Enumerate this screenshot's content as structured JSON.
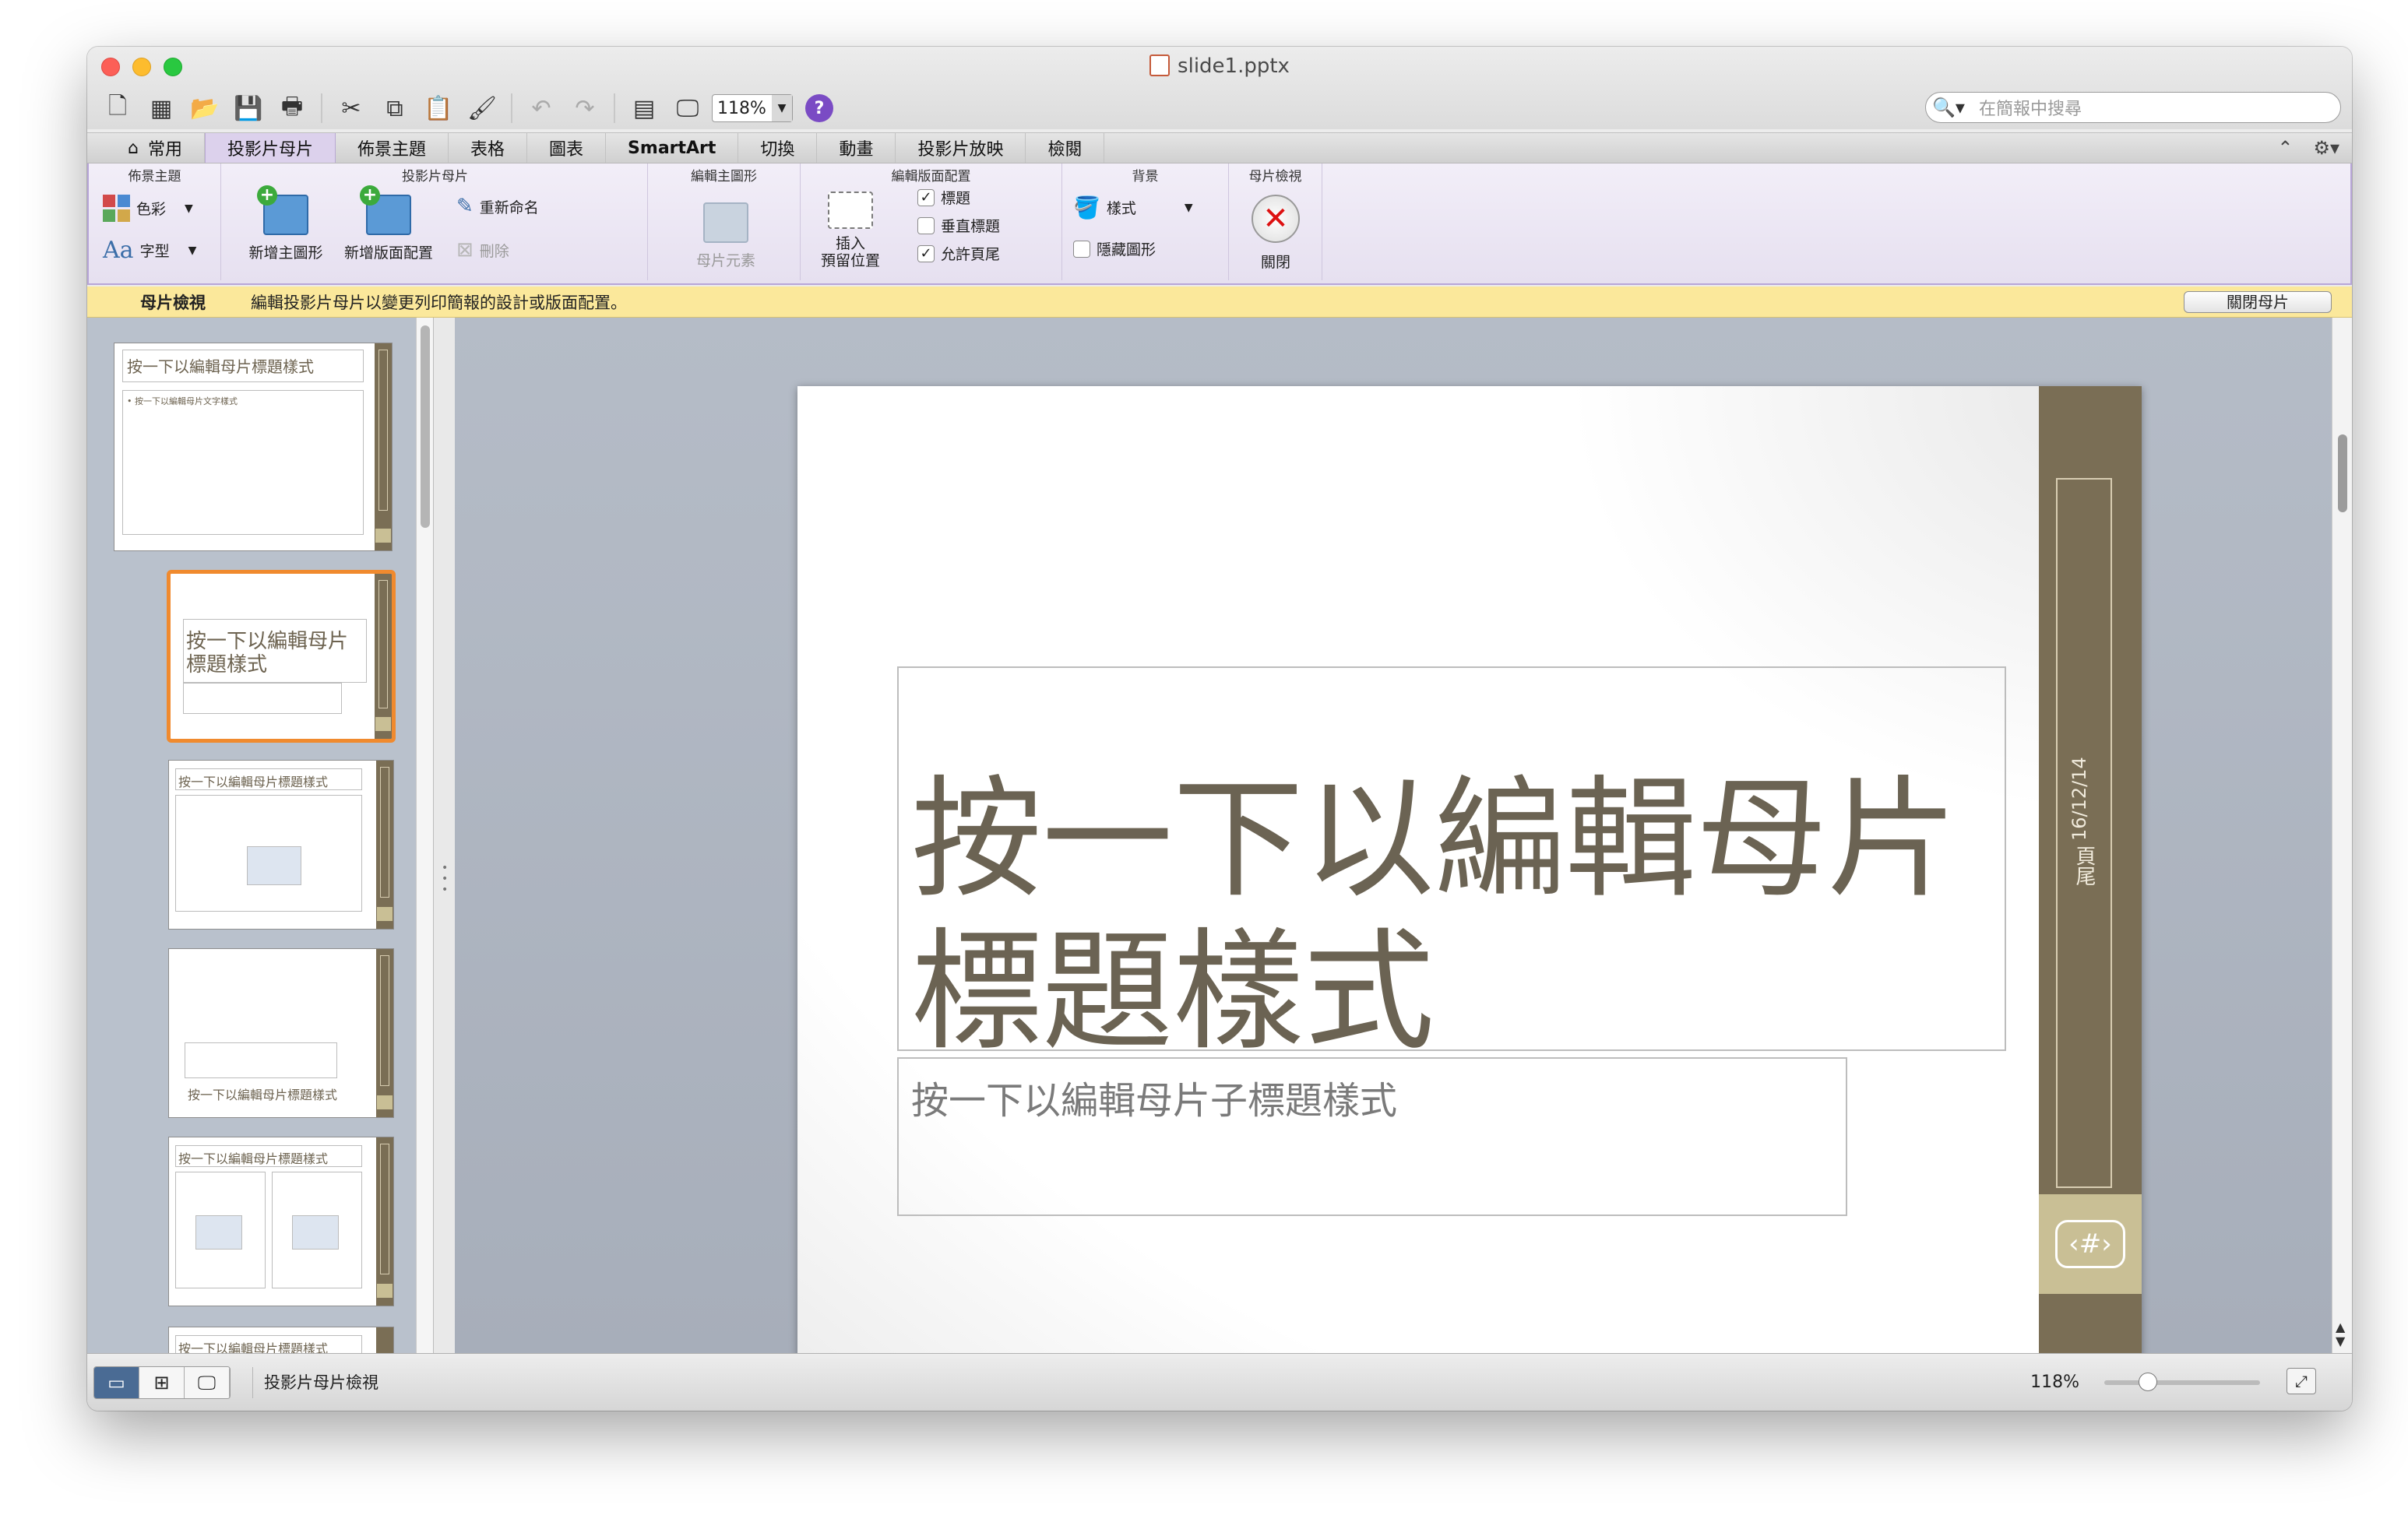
{
  "window": {
    "title": "slide1.pptx"
  },
  "toolbar": {
    "zoom_value": "118%",
    "search_placeholder": "在簡報中搜尋",
    "icons": [
      "new-icon",
      "gallery-icon",
      "open-icon",
      "save-icon",
      "print-icon",
      "cut-icon",
      "copy-icon",
      "paste-icon",
      "format-painter-icon",
      "undo-icon",
      "redo-icon",
      "slide-sorter-icon",
      "show-icon",
      "help-icon"
    ]
  },
  "tabs": [
    {
      "label": "常用"
    },
    {
      "label": "投影片母片",
      "active": true
    },
    {
      "label": "佈景主題"
    },
    {
      "label": "表格"
    },
    {
      "label": "圖表"
    },
    {
      "label": "SmartArt"
    },
    {
      "label": "切換"
    },
    {
      "label": "動畫"
    },
    {
      "label": "投影片放映"
    },
    {
      "label": "檢閱"
    }
  ],
  "ribbon": {
    "theme_group": {
      "title": "佈景主題",
      "colors": "色彩",
      "fonts": "字型",
      "fonts_glyph": "Aa"
    },
    "master_group": {
      "title": "投影片母片",
      "new_master": "新增主圖形",
      "new_layout": "新增版面配置",
      "rename": "重新命名",
      "delete": "刪除"
    },
    "edit_master_group": {
      "title": "編輯主圖形",
      "master_elements": "母片元素"
    },
    "edit_layout_group": {
      "title": "編輯版面配置",
      "insert_placeholder_line1": "插入",
      "insert_placeholder_line2": "預留位置",
      "title_chk": "標題",
      "vertical_title_chk": "垂直標題",
      "footers_chk": "允許頁尾"
    },
    "background_group": {
      "title": "背景",
      "styles": "樣式",
      "hide_graphics": "隱藏圖形"
    },
    "master_view_group": {
      "title": "母片檢視",
      "close": "關閉"
    }
  },
  "message_bar": {
    "label": "母片檢視",
    "text": "編輯投影片母片以變更列印簡報的設計或版面配置。",
    "button": "關閉母片"
  },
  "thumbnails": {
    "master_title": "按一下以編輯母片標題樣式",
    "master_body": "• 按一下以編輯母片文字樣式",
    "title_layout": "按一下以編輯母片標題樣式"
  },
  "slide": {
    "title": "按一下以編輯母片標題樣式",
    "subtitle": "按一下以編輯母片子標題樣式",
    "date": "16/12/14",
    "footer": "頁尾",
    "slide_number": "‹#›"
  },
  "status": {
    "view_label": "投影片母片檢視",
    "zoom": "118%",
    "zoom_fraction": 0.28
  },
  "colors": {
    "accent_band": "#7a6e55",
    "accent_light": "#c9bf95",
    "title_text": "#6b6353",
    "selection": "#f08a2e",
    "ribbon": "#e6e0f0"
  }
}
